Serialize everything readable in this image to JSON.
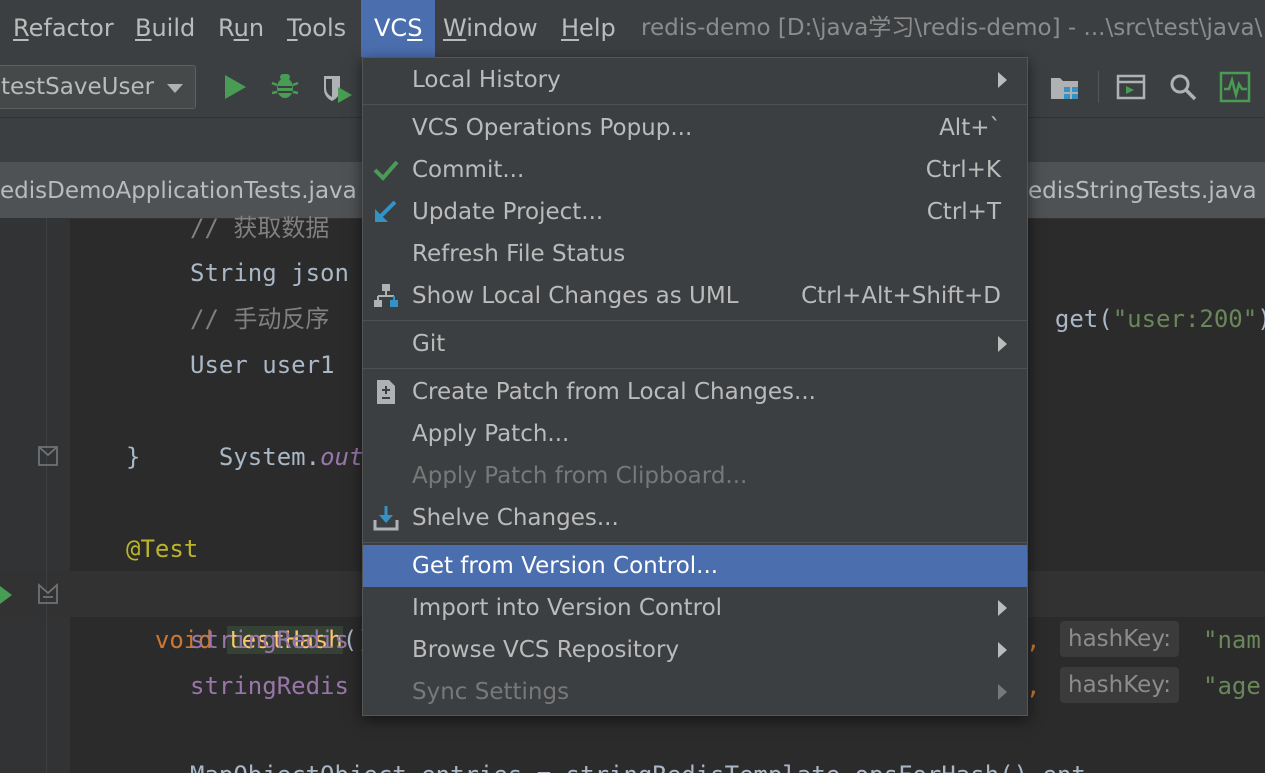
{
  "menubar": {
    "items": [
      {
        "label": "Refactor",
        "mnemonic": "R"
      },
      {
        "label": "Build",
        "mnemonic": "B"
      },
      {
        "label": "Run",
        "mnemonic": "u"
      },
      {
        "label": "Tools",
        "mnemonic": "T"
      },
      {
        "label": "VCS",
        "mnemonic": "S"
      },
      {
        "label": "Window",
        "mnemonic": "W"
      },
      {
        "label": "Help",
        "mnemonic": "H"
      }
    ],
    "window_title": "redis-demo [D:\\java学习\\redis-demo] - ...\\src\\test\\java\\"
  },
  "toolbar": {
    "run_config": "testSaveUser",
    "icons": [
      "run-icon",
      "debug-icon",
      "coverage-icon",
      "project-structure-icon",
      "terminal-icon",
      "search-icon",
      "profiler-icon"
    ]
  },
  "tabs": {
    "left": "edisDemoApplicationTests.java",
    "right": "edisStringTests.java"
  },
  "editor": {
    "comment1": "// 获取数据",
    "line2a": "String json",
    "line2b": "get(",
    "line2str": "\"user:200\"",
    "line2c": ")",
    "comment2": "// 手动反序",
    "line4": "User user1",
    "line5a": "System.",
    "line5b": "out",
    "line5c": ".",
    "brace": "}",
    "annotation": "@Test",
    "kw_void": "void",
    "method": "testHash",
    "paren": "()",
    "field": "stringRedis",
    "hint_label": "hashKey:",
    "comma": ",",
    "hint_str1": "\"nam",
    "hint_str2": "\"age",
    "last_line": "MapObjectObject entries = stringRedisTemplate.opsForHash().ent"
  },
  "vcs_menu": {
    "items": [
      {
        "label": "Local History",
        "submenu": true
      },
      {
        "label": "VCS Operations Popup...",
        "shortcut": "Alt+`"
      },
      {
        "label": "Commit...",
        "shortcut": "Ctrl+K",
        "icon": "check-icon"
      },
      {
        "label": "Update Project...",
        "shortcut": "Ctrl+T",
        "icon": "update-icon"
      },
      {
        "label": "Refresh File Status"
      },
      {
        "label": "Show Local Changes as UML",
        "shortcut": "Ctrl+Alt+Shift+D",
        "icon": "uml-icon"
      },
      {
        "label": "Git",
        "submenu": true
      },
      {
        "label": "Create Patch from Local Changes...",
        "icon": "patch-icon"
      },
      {
        "label": "Apply Patch..."
      },
      {
        "label": "Apply Patch from Clipboard...",
        "disabled": true
      },
      {
        "label": "Shelve Changes...",
        "icon": "shelve-icon"
      },
      {
        "label": "Get from Version Control...",
        "selected": true
      },
      {
        "label": "Import into Version Control",
        "submenu": true
      },
      {
        "label": "Browse VCS Repository",
        "submenu": true
      },
      {
        "label": "Sync Settings",
        "submenu": true,
        "disabled": true
      }
    ]
  },
  "colors": {
    "menu_bg": "#3c3f41",
    "selection": "#4b6eaf",
    "editor_bg": "#2b2b2b",
    "run_green": "#499c54"
  }
}
